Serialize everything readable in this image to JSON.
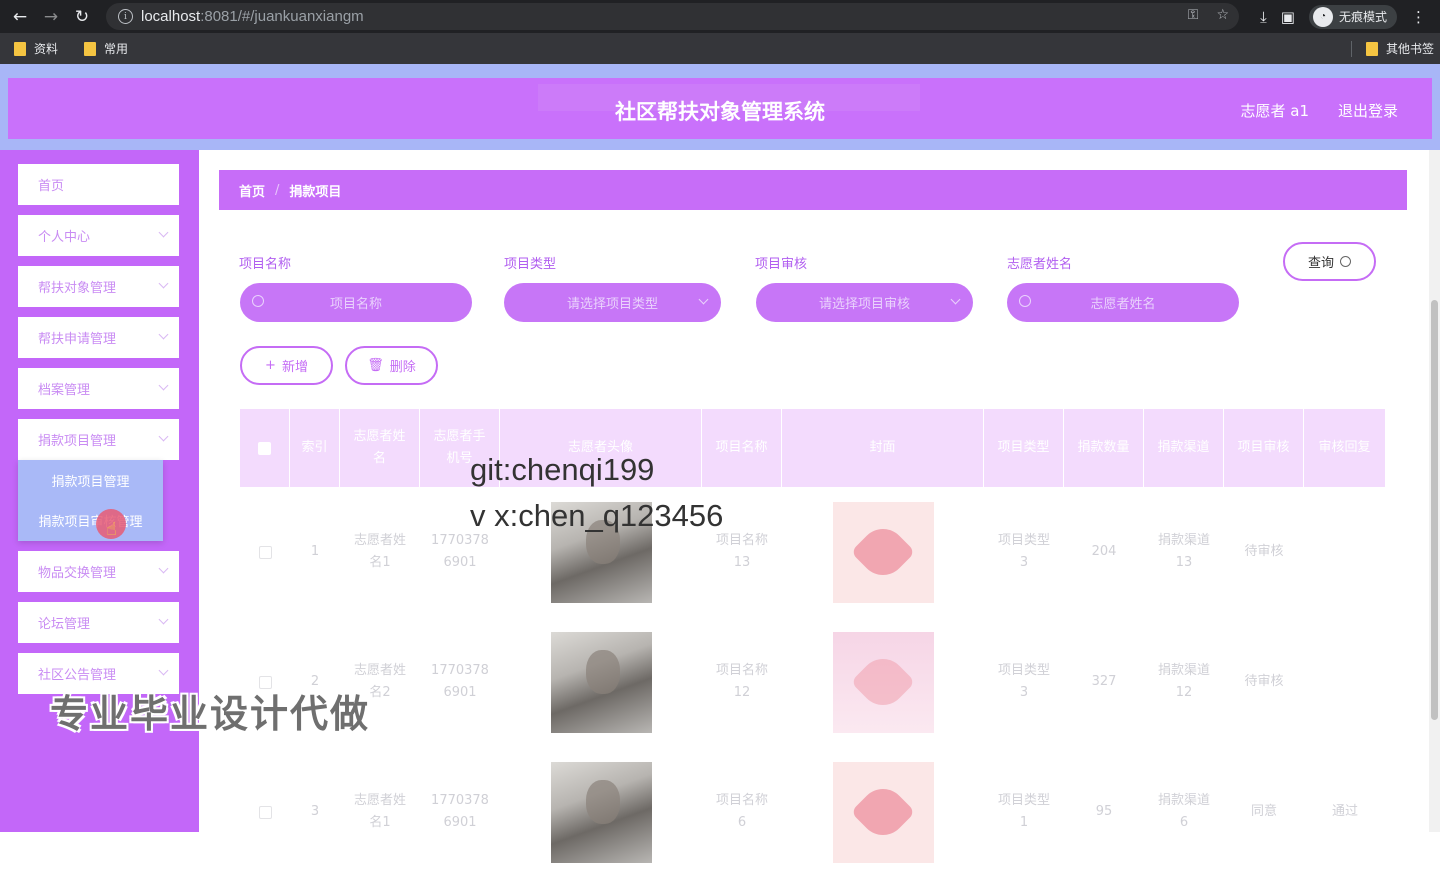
{
  "browser": {
    "url_host": "localhost",
    "url_rest": ":8081/#/juankuanxiangm",
    "incognito_label": "无痕模式",
    "bookmarks": [
      "资料",
      "常用"
    ],
    "other_bookmarks": "其他书签"
  },
  "header": {
    "title": "社区帮扶对象管理系统",
    "user": "志愿者 a1",
    "logout": "退出登录"
  },
  "sidebar": {
    "items": [
      {
        "label": "首页",
        "has_arrow": false
      },
      {
        "label": "个人中心",
        "has_arrow": true
      },
      {
        "label": "帮扶对象管理",
        "has_arrow": true
      },
      {
        "label": "帮扶申请管理",
        "has_arrow": true
      },
      {
        "label": "档案管理",
        "has_arrow": true
      },
      {
        "label": "捐款项目管理",
        "has_arrow": true
      },
      {
        "label": "物品交换管理",
        "has_arrow": true
      },
      {
        "label": "论坛管理",
        "has_arrow": true
      },
      {
        "label": "社区公告管理",
        "has_arrow": true
      }
    ],
    "submenu": [
      "捐款项目管理",
      "捐款项目审核管理"
    ]
  },
  "breadcrumb": {
    "home": "首页",
    "sep": "/",
    "current": "捐款项目"
  },
  "filters": {
    "project_name": {
      "label": "项目名称",
      "placeholder": "项目名称"
    },
    "project_type": {
      "label": "项目类型",
      "placeholder": "请选择项目类型"
    },
    "project_review": {
      "label": "项目审核",
      "placeholder": "请选择项目审核"
    },
    "volunteer_name": {
      "label": "志愿者姓名",
      "placeholder": "志愿者姓名"
    },
    "search_label": "查询"
  },
  "actions": {
    "add": "新增",
    "delete": "删除"
  },
  "table": {
    "headers": [
      "索引",
      "志愿者姓名",
      "志愿者手机号",
      "志愿者头像",
      "项目名称",
      "封面",
      "项目类型",
      "捐款数量",
      "捐款渠道",
      "项目审核",
      "审核回复"
    ],
    "rows": [
      {
        "index": "1",
        "name": "志愿者姓名1",
        "phone": "17703786901",
        "project": "项目名称13",
        "type": "项目类型3",
        "amount": "204",
        "channel": "捐款渠道13",
        "review": "待审核",
        "reply": ""
      },
      {
        "index": "2",
        "name": "志愿者姓名2",
        "phone": "17703786901",
        "project": "项目名称12",
        "type": "项目类型3",
        "amount": "327",
        "channel": "捐款渠道12",
        "review": "待审核",
        "reply": ""
      },
      {
        "index": "3",
        "name": "志愿者姓名1",
        "phone": "17703786901",
        "project": "项目名称6",
        "type": "项目类型1",
        "amount": "95",
        "channel": "捐款渠道6",
        "review": "同意",
        "reply": "通过"
      }
    ]
  },
  "overlay": {
    "line1": "git:chenqi199",
    "line2": "v x:chen_q123456",
    "watermark": "专业毕业设计代做"
  }
}
